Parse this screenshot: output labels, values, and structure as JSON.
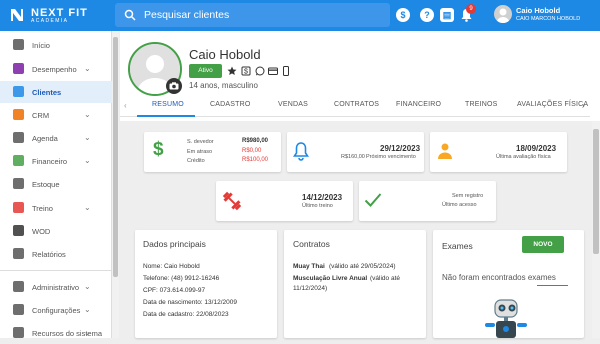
{
  "topbar": {
    "logo_main": "NEXT FIT",
    "logo_sub": "ACADEMIA",
    "search_placeholder": "Pesquisar clientes",
    "help_icon": "?",
    "notification_count": "9",
    "user_name": "Caio Hobold",
    "user_company": "CAIO MARCON HOBOLD"
  },
  "sidebar": {
    "items": [
      {
        "label": "Início",
        "icon": "home-icon"
      },
      {
        "label": "Desempenho",
        "icon": "chart-icon",
        "chevron": "⌄"
      },
      {
        "label": "Clientes",
        "icon": "people-icon",
        "active": true
      },
      {
        "label": "CRM",
        "icon": "crm-icon",
        "chevron": "⌄"
      },
      {
        "label": "Agenda",
        "icon": "calendar-icon",
        "chevron": "⌄"
      },
      {
        "label": "Financeiro",
        "icon": "money-icon",
        "chevron": "⌄"
      },
      {
        "label": "Estoque",
        "icon": "cart-icon"
      },
      {
        "label": "Treino",
        "icon": "dumbbell-icon",
        "chevron": "⌄"
      },
      {
        "label": "WOD",
        "icon": "kettlebell-icon"
      },
      {
        "label": "Relatórios",
        "icon": "report-icon"
      },
      {
        "label": "Administrativo",
        "icon": "admin-icon",
        "chevron": "⌄"
      },
      {
        "label": "Configurações",
        "icon": "settings-icon",
        "chevron": "⌄"
      },
      {
        "label": "Recursos do sistema",
        "icon": "resources-icon",
        "chevron": "⌄"
      }
    ]
  },
  "profile": {
    "name": "Caio Hobold",
    "status": "Ativo",
    "info": "14 anos, masculino"
  },
  "tabs": [
    "RESUMO",
    "CADASTRO",
    "VENDAS",
    "CONTRATOS",
    "FINANCEIRO",
    "TREINOS",
    "AVALIAÇÕES FÍSICA"
  ],
  "summary": {
    "finance": {
      "saldo_label": "S. devedor",
      "saldo_value": "R$980,00",
      "atraso_label": "Em atraso",
      "atraso_value": "R$0,00",
      "credito_label": "Crédito",
      "credito_value": "R$100,00"
    },
    "next_due": {
      "date": "29/12/2023",
      "amount": "R$160,00",
      "label": "Próximo vencimento"
    },
    "last_evaluation": {
      "date": "18/09/2023",
      "label": "Última avaliação física"
    },
    "last_training": {
      "date": "14/12/2023",
      "label": "Último treino"
    },
    "last_access": {
      "date": "Sem registro",
      "label": "Último acesso"
    }
  },
  "principal": {
    "title": "Dados principais",
    "fields": [
      "Nome: Caio Hobold",
      "Telefone: (48) 9912-16246",
      "CPF: 073.614.099-97",
      "Data de nascimento: 13/12/2009",
      "Data de cadastro: 22/08/2023"
    ]
  },
  "contracts": {
    "title": "Contratos",
    "items": [
      {
        "name": "Muay Thai",
        "detail": "(válido até 29/05/2024)"
      },
      {
        "name": "Musculação Livre Anual",
        "detail": "(válido até"
      },
      {
        "name": "",
        "detail": "11/12/2024)"
      }
    ]
  },
  "exams": {
    "title": "Exames",
    "button": "NOVO",
    "empty_text": "Não foram encontrados exames"
  },
  "colors": {
    "primary": "#1e88e5",
    "success": "#43a047",
    "danger": "#e53935",
    "warning": "#f9a825"
  }
}
